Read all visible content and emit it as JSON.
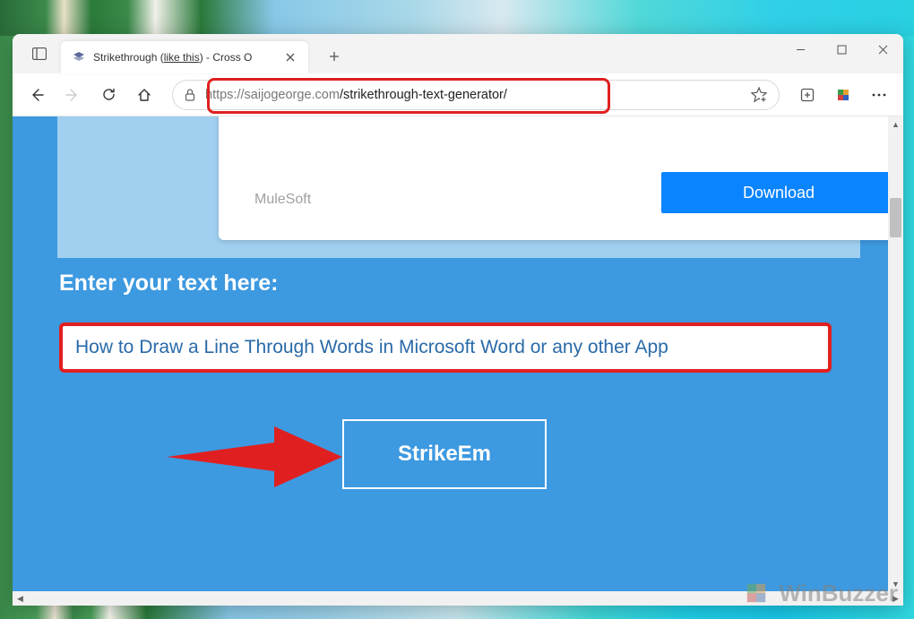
{
  "tab": {
    "title_prefix": "Strikethrough (",
    "title_strike": "like this",
    "title_suffix": ") - Cross O"
  },
  "addressbar": {
    "scheme": "https://",
    "host": "saijogeorge.com",
    "path": "/strikethrough-text-generator/"
  },
  "ad": {
    "label": "MuleSoft",
    "button": "Download"
  },
  "page": {
    "enter_label": "Enter your text here:",
    "input_value": "How to Draw a Line Through Words in Microsoft Word or any other App",
    "strike_button": "StrikeEm"
  },
  "watermark": "WinBuzzer"
}
